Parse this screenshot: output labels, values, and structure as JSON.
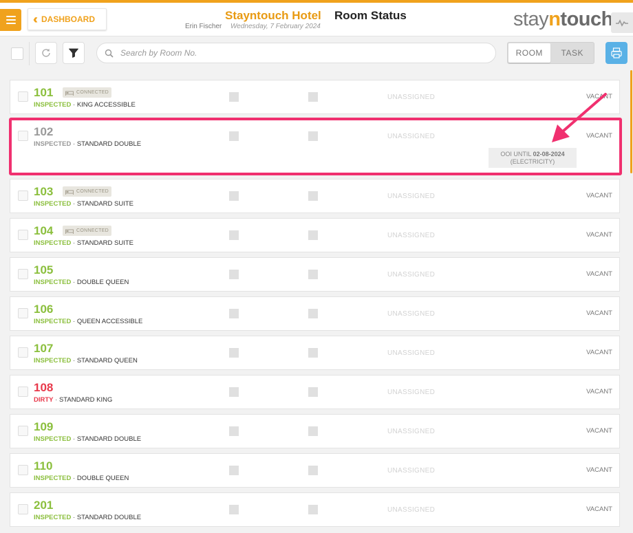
{
  "header": {
    "dashboard_label": "DASHBOARD",
    "hotel_name": "Stayntouch Hotel",
    "page_title": "Room Status",
    "user_name": "Erin Fischer",
    "date": "Wednesday, 7 February 2024",
    "logo": {
      "part1": "stay",
      "part2": "n",
      "part3": "touch"
    }
  },
  "toolbar": {
    "search_placeholder": "Search by Room No.",
    "search_value": "",
    "view_toggle": [
      {
        "label": "ROOM",
        "active": true
      },
      {
        "label": "TASK",
        "active": false
      }
    ]
  },
  "rooms": [
    {
      "number": "101",
      "number_color": "green",
      "status": "INSPECTED",
      "status_color": "green",
      "type": "KING ACCESSIBLE",
      "connected": "CONNECTED",
      "assignment": "UNASSIGNED",
      "occupancy": "VACANT"
    },
    {
      "number": "102",
      "number_color": "grey",
      "status": "INSPECTED",
      "status_color": "grey",
      "type": "STANDARD DOUBLE",
      "assignment": "UNASSIGNED",
      "occupancy": "VACANT",
      "ooi_prefix": "OOI UNTIL ",
      "ooi_date": "02-08-2024",
      "ooi_reason": "(ELECTRICITY)",
      "highlighted": true
    },
    {
      "number": "103",
      "number_color": "green",
      "status": "INSPECTED",
      "status_color": "green",
      "type": "STANDARD SUITE",
      "connected": "CONNECTED",
      "assignment": "UNASSIGNED",
      "occupancy": "VACANT"
    },
    {
      "number": "104",
      "number_color": "green",
      "status": "INSPECTED",
      "status_color": "green",
      "type": "STANDARD SUITE",
      "connected": "CONNECTED",
      "assignment": "UNASSIGNED",
      "occupancy": "VACANT"
    },
    {
      "number": "105",
      "number_color": "green",
      "status": "INSPECTED",
      "status_color": "green",
      "type": "DOUBLE QUEEN",
      "assignment": "UNASSIGNED",
      "occupancy": "VACANT"
    },
    {
      "number": "106",
      "number_color": "green",
      "status": "INSPECTED",
      "status_color": "green",
      "type": "QUEEN ACCESSIBLE",
      "assignment": "UNASSIGNED",
      "occupancy": "VACANT"
    },
    {
      "number": "107",
      "number_color": "green",
      "status": "INSPECTED",
      "status_color": "green",
      "type": "STANDARD QUEEN",
      "assignment": "UNASSIGNED",
      "occupancy": "VACANT"
    },
    {
      "number": "108",
      "number_color": "red",
      "status": "DIRTY",
      "status_color": "red",
      "type": "STANDARD KING",
      "assignment": "UNASSIGNED",
      "occupancy": "VACANT"
    },
    {
      "number": "109",
      "number_color": "green",
      "status": "INSPECTED",
      "status_color": "green",
      "type": "STANDARD DOUBLE",
      "assignment": "UNASSIGNED",
      "occupancy": "VACANT"
    },
    {
      "number": "110",
      "number_color": "green",
      "status": "INSPECTED",
      "status_color": "green",
      "type": "DOUBLE QUEEN",
      "assignment": "UNASSIGNED",
      "occupancy": "VACANT"
    },
    {
      "number": "201",
      "number_color": "green",
      "status": "INSPECTED",
      "status_color": "green",
      "type": "STANDARD DOUBLE",
      "assignment": "UNASSIGNED",
      "occupancy": "VACANT"
    }
  ],
  "colors": {
    "accent": "#f0a21d",
    "inspected": "#8bbf3d",
    "dirty": "#e8394b",
    "highlight": "#f0306f",
    "print_button": "#5ab1e6"
  }
}
